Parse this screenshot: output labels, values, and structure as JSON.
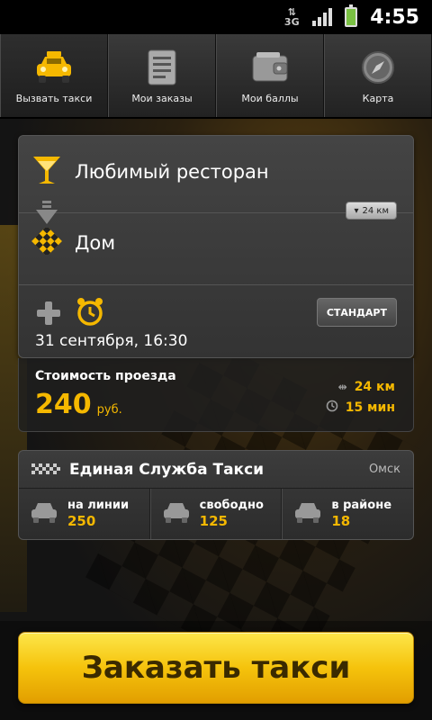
{
  "status_bar": {
    "network": "3G",
    "time": "4:55"
  },
  "tabs": [
    {
      "label": "Вызвать такси",
      "icon": "taxi-icon"
    },
    {
      "label": "Мои заказы",
      "icon": "orders-list-icon"
    },
    {
      "label": "Мои баллы",
      "icon": "wallet-icon"
    },
    {
      "label": "Карта",
      "icon": "compass-icon"
    }
  ],
  "route": {
    "from": "Любимый ресторан",
    "to": "Дом",
    "distance": "24 км",
    "date": "31 сентября, 16:30",
    "class_label": "СТАНДАРТ"
  },
  "fare": {
    "label": "Стоимость проезда",
    "price": "240",
    "currency": "руб.",
    "distance": "24 км",
    "duration": "15 мин"
  },
  "service": {
    "name": "Единая Служба Такси",
    "city": "Омск",
    "stats": [
      {
        "label": "на линии",
        "value": "250"
      },
      {
        "label": "свободно",
        "value": "125"
      },
      {
        "label": "в районе",
        "value": "18"
      }
    ]
  },
  "order_button": "Заказать такси",
  "colors": {
    "accent": "#f5b800",
    "button_top": "#fde64a",
    "button_bottom": "#e29e00"
  }
}
